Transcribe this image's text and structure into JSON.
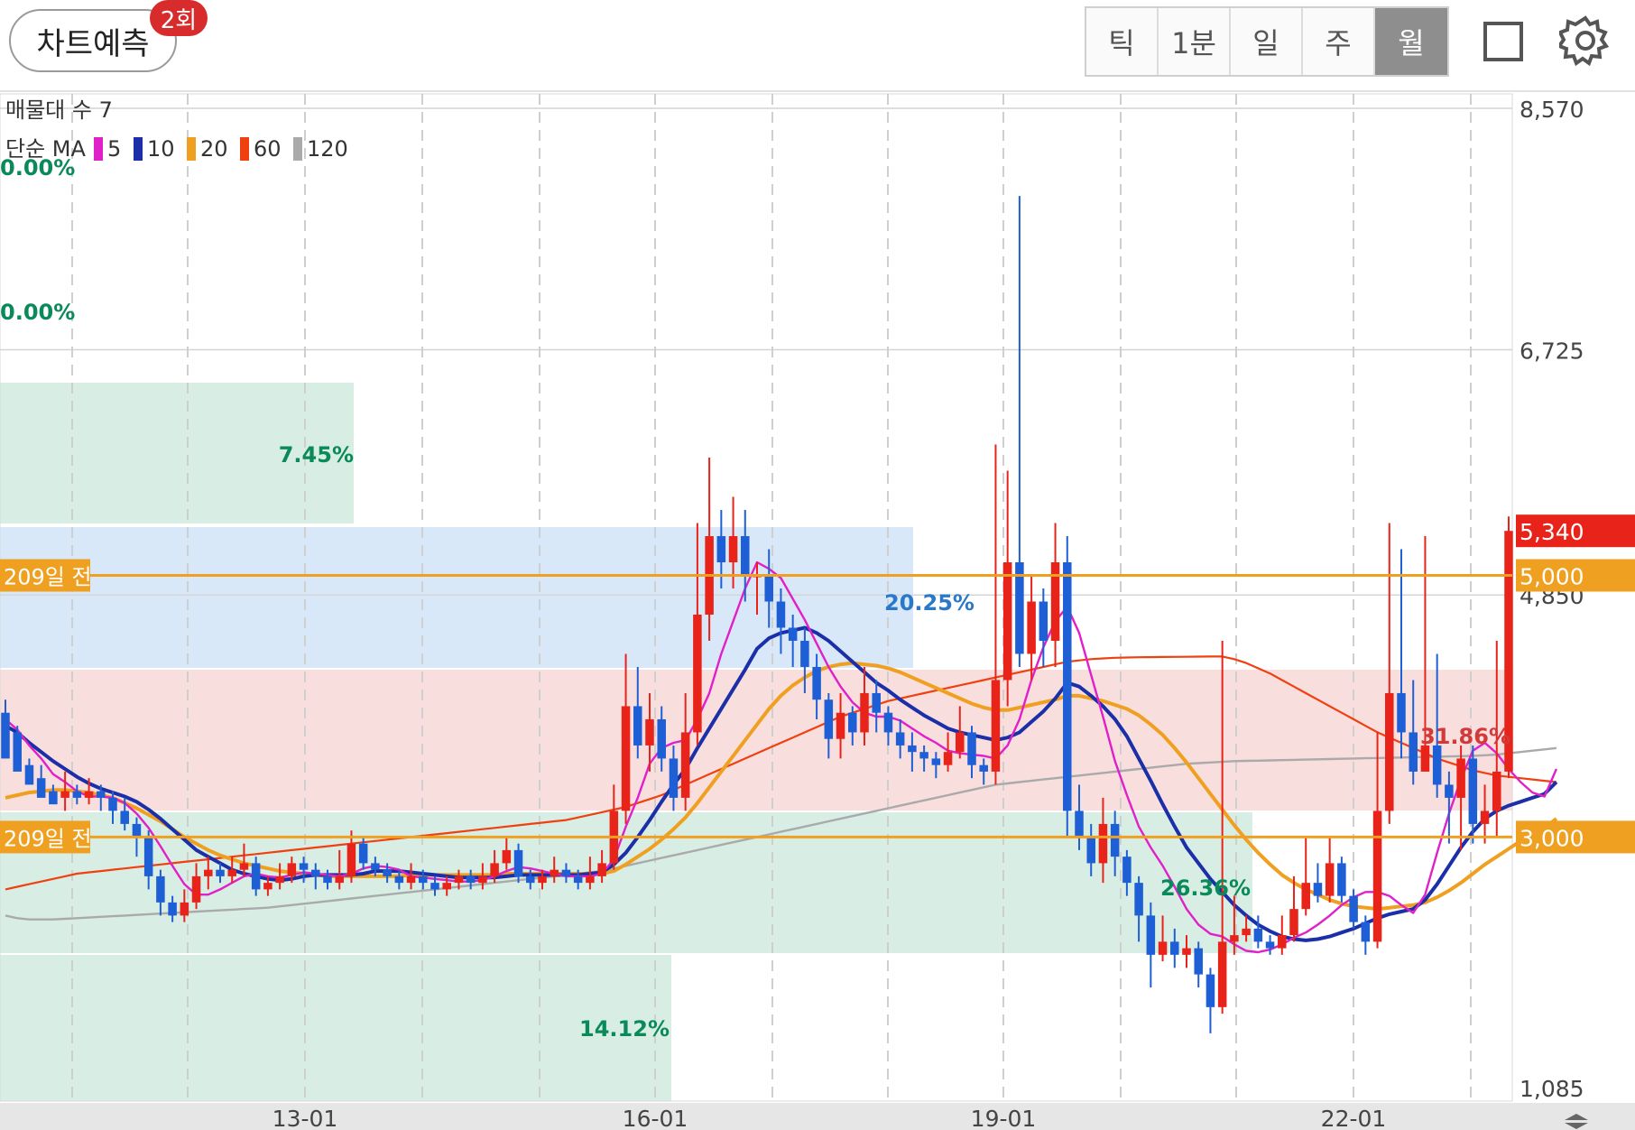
{
  "toolbar": {
    "predict_label": "차트예측",
    "predict_badge": "2회",
    "periods": [
      "틱",
      "1분",
      "일",
      "주",
      "월"
    ],
    "active_period": "월"
  },
  "legend": {
    "volume_profile": "매물대 수 7",
    "ma_title": "단순 MA",
    "ma": [
      {
        "label": "5",
        "color": "#e020c8"
      },
      {
        "label": "10",
        "color": "#1a2fa8"
      },
      {
        "label": "20",
        "color": "#f0a020"
      },
      {
        "label": "60",
        "color": "#f04010"
      },
      {
        "label": "120",
        "color": "#aaaaaa"
      }
    ]
  },
  "colors": {
    "up": "#e8231a",
    "down": "#1f5fd6",
    "ref_line": "#f0a020"
  },
  "chart_data": {
    "type": "candlestick",
    "y_axis": {
      "min": 1085,
      "max": 8570,
      "ticks": [
        "8,570",
        "6,725",
        "4,850",
        "1,085"
      ]
    },
    "x_axis": {
      "ticks": [
        "13-01",
        "16-01",
        "19-01",
        "22-01"
      ]
    },
    "price_tags": [
      {
        "label": "5,340",
        "value": 5340,
        "color": "#e8231a"
      },
      {
        "label": "5,000",
        "value": 5000,
        "color": "#f0a020"
      },
      {
        "label": "3,000",
        "value": 3000,
        "color": "#f0a020"
      }
    ],
    "reference_lines": [
      {
        "label": "209일 전",
        "value": 5000
      },
      {
        "label": "209일 전",
        "value": 3000
      }
    ],
    "volume_profile": [
      {
        "label": "0.00%",
        "color": "#0a8a5a"
      },
      {
        "label": "0.00%",
        "color": "#0a8a5a"
      },
      {
        "label": "7.45%",
        "color": "#0a8a5a"
      },
      {
        "label": "20.25%",
        "color": "#2a78c8"
      },
      {
        "label": "31.86%",
        "color": "#d23a3a"
      },
      {
        "label": "26.36%",
        "color": "#0a8a5a"
      },
      {
        "label": "14.12%",
        "color": "#0a8a5a"
      }
    ],
    "candles": [
      [
        3950,
        3600,
        4050,
        3800
      ],
      [
        3800,
        3500,
        3850,
        3550
      ],
      [
        3550,
        3400,
        3600,
        3450
      ],
      [
        3450,
        3300,
        3550,
        3350
      ],
      [
        3350,
        3250,
        3400,
        3300
      ],
      [
        3300,
        3350,
        3500,
        3200
      ],
      [
        3350,
        3300,
        3400,
        3250
      ],
      [
        3300,
        3350,
        3450,
        3250
      ],
      [
        3350,
        3300,
        3400,
        3200
      ],
      [
        3300,
        3200,
        3350,
        3100
      ],
      [
        3200,
        3100,
        3300,
        3050
      ],
      [
        3100,
        3000,
        3150,
        2850
      ],
      [
        3000,
        2700,
        3050,
        2600
      ],
      [
        2700,
        2500,
        2750,
        2400
      ],
      [
        2500,
        2400,
        2550,
        2350
      ],
      [
        2400,
        2500,
        2600,
        2350
      ],
      [
        2500,
        2700,
        2800,
        2450
      ],
      [
        2700,
        2750,
        2850,
        2600
      ],
      [
        2750,
        2700,
        2800,
        2650
      ],
      [
        2700,
        2750,
        2850,
        2650
      ],
      [
        2750,
        2800,
        2950,
        2700
      ],
      [
        2800,
        2600,
        2850,
        2550
      ],
      [
        2600,
        2650,
        2700,
        2550
      ],
      [
        2650,
        2700,
        2800,
        2600
      ],
      [
        2700,
        2800,
        2850,
        2650
      ],
      [
        2800,
        2750,
        2850,
        2650
      ],
      [
        2750,
        2700,
        2800,
        2600
      ],
      [
        2700,
        2650,
        2750,
        2600
      ],
      [
        2650,
        2700,
        2900,
        2600
      ],
      [
        2700,
        2950,
        3050,
        2650
      ],
      [
        2950,
        2800,
        3000,
        2750
      ],
      [
        2800,
        2750,
        2850,
        2700
      ],
      [
        2750,
        2700,
        2800,
        2650
      ],
      [
        2700,
        2650,
        2750,
        2600
      ],
      [
        2650,
        2700,
        2800,
        2600
      ],
      [
        2700,
        2650,
        2750,
        2600
      ],
      [
        2650,
        2600,
        2700,
        2550
      ],
      [
        2600,
        2650,
        2700,
        2550
      ],
      [
        2650,
        2700,
        2750,
        2600
      ],
      [
        2700,
        2650,
        2750,
        2600
      ],
      [
        2650,
        2700,
        2800,
        2600
      ],
      [
        2700,
        2800,
        2900,
        2650
      ],
      [
        2800,
        2900,
        3000,
        2750
      ],
      [
        2900,
        2700,
        2950,
        2650
      ],
      [
        2700,
        2650,
        2750,
        2600
      ],
      [
        2650,
        2700,
        2750,
        2600
      ],
      [
        2700,
        2750,
        2850,
        2650
      ],
      [
        2750,
        2700,
        2800,
        2650
      ],
      [
        2700,
        2650,
        2750,
        2600
      ],
      [
        2650,
        2700,
        2850,
        2600
      ],
      [
        2700,
        2800,
        2900,
        2650
      ],
      [
        2800,
        3200,
        3400,
        2750
      ],
      [
        3200,
        4000,
        4400,
        3100
      ],
      [
        4000,
        3700,
        4300,
        3600
      ],
      [
        3700,
        3900,
        4100,
        3500
      ],
      [
        3900,
        3600,
        4000,
        3500
      ],
      [
        3600,
        3300,
        3700,
        3200
      ],
      [
        3300,
        3800,
        4100,
        3200
      ],
      [
        3800,
        4700,
        5400,
        3700
      ],
      [
        4700,
        5300,
        5900,
        4500
      ],
      [
        5300,
        5100,
        5500,
        4900
      ],
      [
        5100,
        5300,
        5600,
        4900
      ],
      [
        5300,
        5000,
        5500,
        4800
      ],
      [
        5000,
        5000,
        5100,
        4700
      ],
      [
        5000,
        4800,
        5200,
        4600
      ],
      [
        4800,
        4600,
        4900,
        4400
      ],
      [
        4600,
        4500,
        4700,
        4300
      ],
      [
        4500,
        4300,
        4600,
        4100
      ],
      [
        4300,
        4050,
        4400,
        3900
      ],
      [
        4050,
        3750,
        4100,
        3600
      ],
      [
        3750,
        3950,
        4100,
        3600
      ],
      [
        3950,
        3800,
        4000,
        3700
      ],
      [
        3800,
        4100,
        4300,
        3700
      ],
      [
        4100,
        3950,
        4200,
        3800
      ],
      [
        3950,
        3800,
        4000,
        3700
      ],
      [
        3800,
        3700,
        3900,
        3600
      ],
      [
        3700,
        3650,
        3800,
        3500
      ],
      [
        3650,
        3600,
        3700,
        3500
      ],
      [
        3600,
        3550,
        3650,
        3450
      ],
      [
        3550,
        3650,
        3800,
        3500
      ],
      [
        3650,
        3800,
        4000,
        3600
      ],
      [
        3800,
        3550,
        3850,
        3450
      ],
      [
        3550,
        3500,
        3600,
        3400
      ],
      [
        3500,
        4200,
        6000,
        3400
      ],
      [
        4200,
        5100,
        5800,
        4000
      ],
      [
        5100,
        4400,
        7900,
        4300
      ],
      [
        4400,
        4800,
        5000,
        4200
      ],
      [
        4800,
        4500,
        4900,
        4300
      ],
      [
        4500,
        5100,
        5400,
        4300
      ],
      [
        5100,
        3200,
        5300,
        3000
      ],
      [
        3200,
        3000,
        3400,
        2900
      ],
      [
        3000,
        2800,
        3100,
        2700
      ],
      [
        2800,
        3100,
        3300,
        2650
      ],
      [
        3100,
        2850,
        3200,
        2700
      ],
      [
        2850,
        2650,
        2900,
        2550
      ],
      [
        2650,
        2400,
        2700,
        2200
      ],
      [
        2400,
        2100,
        2500,
        1850
      ],
      [
        2100,
        2200,
        2400,
        2050
      ],
      [
        2200,
        2100,
        2300,
        2000
      ],
      [
        2100,
        2150,
        2250,
        2000
      ],
      [
        2150,
        1950,
        2200,
        1850
      ],
      [
        1950,
        1700,
        2000,
        1500
      ],
      [
        1700,
        2200,
        4500,
        1650
      ],
      [
        2200,
        2250,
        2550,
        2100
      ],
      [
        2250,
        2300,
        2400,
        2200
      ],
      [
        2300,
        2200,
        2400,
        2150
      ],
      [
        2200,
        2150,
        2250,
        2100
      ],
      [
        2150,
        2250,
        2400,
        2100
      ],
      [
        2250,
        2450,
        2700,
        2200
      ],
      [
        2450,
        2650,
        3000,
        2400
      ],
      [
        2650,
        2550,
        2800,
        2500
      ],
      [
        2550,
        2800,
        3000,
        2500
      ],
      [
        2800,
        2550,
        2850,
        2500
      ],
      [
        2550,
        2350,
        2600,
        2300
      ],
      [
        2350,
        2200,
        2400,
        2100
      ],
      [
        2200,
        3200,
        3800,
        2150
      ],
      [
        3200,
        4100,
        5400,
        3100
      ],
      [
        4100,
        3800,
        5200,
        3600
      ],
      [
        3800,
        3500,
        4200,
        3400
      ],
      [
        3500,
        3700,
        5300,
        3500
      ],
      [
        3700,
        3400,
        4400,
        3300
      ],
      [
        3400,
        3300,
        3500,
        2950
      ],
      [
        3300,
        3600,
        3700,
        2900
      ],
      [
        3600,
        3100,
        3700,
        2950
      ],
      [
        3100,
        3200,
        3400,
        2950
      ],
      [
        3200,
        3500,
        4500,
        3000
      ],
      [
        3500,
        5340,
        5450,
        3450
      ]
    ],
    "ma5": [
      3900,
      3820,
      3700,
      3600,
      3480,
      3420,
      3350,
      3310,
      3310,
      3300,
      3260,
      3180,
      3070,
      2930,
      2780,
      2640,
      2560,
      2560,
      2600,
      2650,
      2700,
      2720,
      2700,
      2690,
      2710,
      2730,
      2720,
      2710,
      2700,
      2720,
      2760,
      2780,
      2770,
      2750,
      2700,
      2690,
      2680,
      2670,
      2660,
      2660,
      2670,
      2700,
      2740,
      2770,
      2760,
      2740,
      2720,
      2700,
      2700,
      2700,
      2720,
      2830,
      3080,
      3300,
      3560,
      3680,
      3720,
      3740,
      3900,
      4100,
      4400,
      4650,
      4900,
      5100,
      5050,
      4980,
      4820,
      4660,
      4480,
      4300,
      4150,
      4030,
      3950,
      3920,
      3920,
      3890,
      3830,
      3770,
      3720,
      3660,
      3640,
      3630,
      3620,
      3600,
      3700,
      3900,
      4200,
      4450,
      4650,
      4760,
      4560,
      4240,
      3920,
      3580,
      3320,
      3080,
      2920,
      2780,
      2620,
      2450,
      2330,
      2260,
      2240,
      2180,
      2130,
      2120,
      2140,
      2180,
      2230,
      2270,
      2330,
      2400,
      2480,
      2540,
      2580,
      2580,
      2550,
      2480,
      2420,
      2560,
      2880,
      3180,
      3440,
      3660,
      3720,
      3640,
      3520,
      3420,
      3340,
      3310,
      3520
    ],
    "ma10": [
      3850,
      3800,
      3720,
      3650,
      3580,
      3520,
      3460,
      3410,
      3370,
      3340,
      3310,
      3270,
      3210,
      3140,
      3060,
      2980,
      2900,
      2850,
      2800,
      2750,
      2720,
      2700,
      2680,
      2670,
      2680,
      2700,
      2710,
      2710,
      2710,
      2710,
      2720,
      2740,
      2740,
      2740,
      2730,
      2720,
      2710,
      2700,
      2690,
      2690,
      2690,
      2690,
      2700,
      2710,
      2710,
      2710,
      2710,
      2710,
      2710,
      2720,
      2730,
      2790,
      2880,
      3000,
      3130,
      3270,
      3400,
      3520,
      3680,
      3830,
      3980,
      4130,
      4280,
      4440,
      4520,
      4560,
      4580,
      4600,
      4560,
      4500,
      4420,
      4340,
      4260,
      4180,
      4120,
      4050,
      3990,
      3930,
      3880,
      3830,
      3800,
      3780,
      3760,
      3740,
      3760,
      3800,
      3880,
      3960,
      4060,
      4180,
      4150,
      4080,
      4000,
      3900,
      3770,
      3600,
      3430,
      3250,
      3080,
      2920,
      2800,
      2680,
      2580,
      2480,
      2400,
      2330,
      2280,
      2240,
      2220,
      2210,
      2220,
      2240,
      2270,
      2300,
      2340,
      2380,
      2410,
      2430,
      2450,
      2520,
      2640,
      2780,
      2920,
      3040,
      3140,
      3200,
      3240,
      3270,
      3300,
      3330,
      3420
    ],
    "ma20": [
      3300,
      3320,
      3340,
      3350,
      3360,
      3360,
      3350,
      3340,
      3320,
      3300,
      3260,
      3220,
      3170,
      3120,
      3060,
      3000,
      2950,
      2900,
      2860,
      2830,
      2800,
      2780,
      2760,
      2740,
      2730,
      2720,
      2710,
      2700,
      2700,
      2700,
      2700,
      2700,
      2700,
      2700,
      2710,
      2710,
      2710,
      2710,
      2710,
      2710,
      2710,
      2710,
      2720,
      2720,
      2720,
      2720,
      2720,
      2720,
      2720,
      2720,
      2720,
      2740,
      2790,
      2850,
      2910,
      2980,
      3060,
      3150,
      3260,
      3380,
      3500,
      3620,
      3740,
      3860,
      3980,
      4080,
      4160,
      4220,
      4270,
      4300,
      4320,
      4330,
      4320,
      4310,
      4290,
      4260,
      4220,
      4180,
      4140,
      4100,
      4060,
      4020,
      3990,
      3970,
      3970,
      3990,
      4010,
      4030,
      4050,
      4080,
      4080,
      4060,
      4040,
      4010,
      3980,
      3930,
      3860,
      3780,
      3680,
      3570,
      3450,
      3330,
      3210,
      3090,
      2980,
      2880,
      2790,
      2710,
      2650,
      2600,
      2560,
      2520,
      2490,
      2470,
      2460,
      2450,
      2460,
      2470,
      2480,
      2500,
      2540,
      2590,
      2650,
      2720,
      2790,
      2850,
      2910,
      2970,
      3020,
      3070,
      3140
    ],
    "ma60": [
      2600,
      2620,
      2640,
      2660,
      2680,
      2700,
      2720,
      2730,
      2740,
      2750,
      2760,
      2770,
      2780,
      2790,
      2800,
      2810,
      2820,
      2830,
      2840,
      2850,
      2860,
      2870,
      2880,
      2890,
      2900,
      2910,
      2920,
      2930,
      2940,
      2950,
      2960,
      2970,
      2980,
      2990,
      3000,
      3010,
      3020,
      3030,
      3040,
      3050,
      3060,
      3070,
      3080,
      3090,
      3100,
      3110,
      3120,
      3130,
      3150,
      3170,
      3190,
      3210,
      3230,
      3260,
      3290,
      3320,
      3360,
      3400,
      3440,
      3480,
      3520,
      3560,
      3600,
      3640,
      3680,
      3720,
      3760,
      3800,
      3840,
      3880,
      3920,
      3950,
      3980,
      4010,
      4040,
      4060,
      4080,
      4100,
      4120,
      4140,
      4160,
      4180,
      4200,
      4220,
      4240,
      4260,
      4280,
      4300,
      4320,
      4340,
      4350,
      4360,
      4365,
      4370,
      4372,
      4374,
      4375,
      4376,
      4377,
      4378,
      4379,
      4380,
      4380,
      4360,
      4330,
      4290,
      4250,
      4200,
      4150,
      4100,
      4050,
      4000,
      3950,
      3900,
      3850,
      3800,
      3760,
      3720,
      3680,
      3640,
      3600,
      3570,
      3540,
      3510,
      3490,
      3470,
      3460,
      3450,
      3440,
      3430,
      3420
    ],
    "ma120": [
      2400,
      2380,
      2370,
      2370,
      2370,
      2375,
      2380,
      2385,
      2390,
      2395,
      2400,
      2405,
      2410,
      2415,
      2420,
      2425,
      2430,
      2435,
      2440,
      2445,
      2450,
      2455,
      2460,
      2470,
      2480,
      2490,
      2500,
      2510,
      2520,
      2530,
      2540,
      2550,
      2560,
      2570,
      2580,
      2590,
      2600,
      2610,
      2620,
      2630,
      2640,
      2650,
      2660,
      2670,
      2680,
      2690,
      2700,
      2710,
      2720,
      2730,
      2740,
      2760,
      2780,
      2800,
      2820,
      2840,
      2860,
      2880,
      2900,
      2920,
      2940,
      2960,
      2980,
      3000,
      3020,
      3040,
      3060,
      3080,
      3100,
      3120,
      3140,
      3160,
      3180,
      3200,
      3220,
      3240,
      3260,
      3280,
      3300,
      3320,
      3340,
      3360,
      3380,
      3400,
      3410,
      3420,
      3430,
      3440,
      3450,
      3460,
      3470,
      3480,
      3490,
      3500,
      3510,
      3520,
      3530,
      3540,
      3550,
      3560,
      3565,
      3570,
      3575,
      3580,
      3582,
      3584,
      3586,
      3588,
      3590,
      3592,
      3594,
      3596,
      3598,
      3600,
      3602,
      3604,
      3606,
      3608,
      3610,
      3612,
      3614,
      3616,
      3618,
      3620,
      3625,
      3630,
      3640,
      3650,
      3660,
      3670,
      3680
    ]
  }
}
